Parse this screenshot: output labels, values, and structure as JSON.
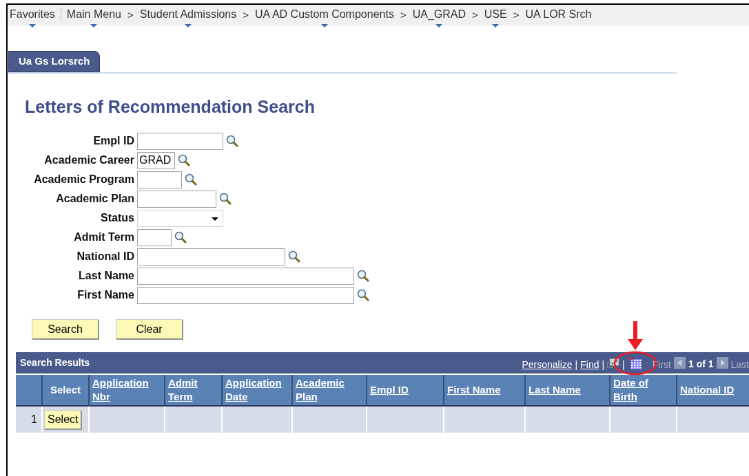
{
  "breadcrumb": [
    {
      "label": "Favorites",
      "has_menu": true
    },
    {
      "label": "Main Menu",
      "has_menu": true
    },
    {
      "label": "Student Admissions",
      "has_menu": true,
      "separator": ">"
    },
    {
      "label": "UA AD Custom Components",
      "has_menu": true,
      "separator": ">"
    },
    {
      "label": "UA_GRAD",
      "has_menu": true,
      "separator": ">"
    },
    {
      "label": "USE",
      "has_menu": true,
      "separator": ">"
    },
    {
      "label": "UA LOR Srch",
      "has_menu": false,
      "separator": ">"
    }
  ],
  "tabs": [
    {
      "label": "Ua Gs Lorsrch",
      "selected": true
    }
  ],
  "heading": "Letters of Recommendation Search",
  "fields": [
    {
      "label": "Empl ID",
      "kind": "lookup"
    },
    {
      "label": "Academic Career",
      "kind": "lookup",
      "value": "GRAD"
    },
    {
      "label": "Academic Program",
      "kind": "lookup"
    },
    {
      "label": "Academic Plan",
      "kind": "lookup"
    },
    {
      "label": "Status",
      "kind": "select"
    },
    {
      "label": "Admit Term",
      "kind": "lookup"
    },
    {
      "label": "National ID",
      "kind": "lookup"
    },
    {
      "label": "Last Name",
      "kind": "lookup"
    },
    {
      "label": "First Name",
      "kind": "lookup"
    }
  ],
  "buttons": [
    "Search",
    "Clear"
  ],
  "results": {
    "title": "Search Results",
    "links": [
      "Personalize",
      "Find"
    ],
    "divider": "|",
    "first": {
      "label": "First",
      "disabled": true
    },
    "count": "1 of 1",
    "last": {
      "label": "Last",
      "disabled": true
    },
    "columns": [
      "Select",
      "Application Nbr",
      "Admit Term",
      "Application Date",
      "Academic Plan",
      "Empl ID",
      "First Name",
      "Last Name",
      "Date of Birth",
      "National ID"
    ],
    "rows": [
      {
        "number": "1",
        "button": "Select"
      }
    ]
  }
}
